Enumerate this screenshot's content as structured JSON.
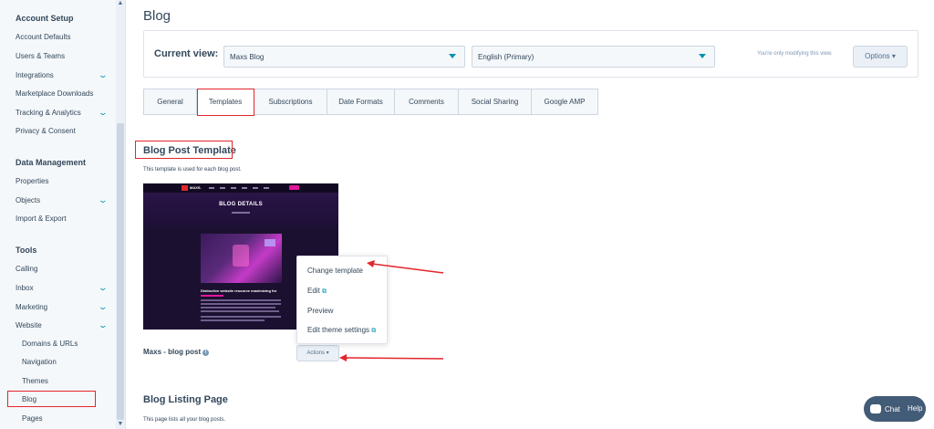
{
  "sidebar": {
    "sections": [
      {
        "title": "Account Setup",
        "items": [
          {
            "label": "Account Defaults",
            "expandable": false
          },
          {
            "label": "Users & Teams",
            "expandable": false
          },
          {
            "label": "Integrations",
            "expandable": true
          },
          {
            "label": "Marketplace Downloads",
            "expandable": false
          },
          {
            "label": "Tracking & Analytics",
            "expandable": true
          },
          {
            "label": "Privacy & Consent",
            "expandable": false
          }
        ]
      },
      {
        "title": "Data Management",
        "items": [
          {
            "label": "Properties",
            "expandable": false
          },
          {
            "label": "Objects",
            "expandable": true
          },
          {
            "label": "Import & Export",
            "expandable": false
          }
        ]
      },
      {
        "title": "Tools",
        "items": [
          {
            "label": "Calling",
            "expandable": false
          },
          {
            "label": "Inbox",
            "expandable": true
          },
          {
            "label": "Marketing",
            "expandable": true
          },
          {
            "label": "Website",
            "expandable": true
          }
        ]
      }
    ],
    "website_subitems": [
      "Domains & URLs",
      "Navigation",
      "Themes",
      "Blog",
      "Pages"
    ],
    "active_item": "Blog"
  },
  "page": {
    "title": "Blog",
    "current_view_label": "Current view:",
    "blog_select": "Maxs Blog",
    "language_select": "English (Primary)",
    "modify_note": "You're only modifying this view.",
    "options_label": "Options ▾"
  },
  "tabs": [
    "General",
    "Templates",
    "Subscriptions",
    "Date Formats",
    "Comments",
    "Social Sharing",
    "Google AMP"
  ],
  "active_tab": "Templates",
  "post_template": {
    "title": "Blog Post Template",
    "description": "This template is used for each blog post.",
    "name": "Maxs - blog post",
    "actions_label": "Actions ▾",
    "preview": {
      "logo": "MAXS.",
      "banner_title": "BLOG DETAILS",
      "headline": "Distinctive website resource maximizing for"
    }
  },
  "actions_menu": [
    {
      "label": "Change template",
      "external": false
    },
    {
      "label": "Edit",
      "external": true
    },
    {
      "label": "Preview",
      "external": false
    },
    {
      "label": "Edit theme settings",
      "external": true
    }
  ],
  "listing": {
    "title": "Blog Listing Page",
    "description": "This page lists all your blog posts."
  },
  "chat": {
    "chat_label": "Chat",
    "help_label": "Help"
  },
  "colors": {
    "annotation_red": "#e3262d",
    "accent": "#0091ae",
    "text": "#33475b"
  }
}
